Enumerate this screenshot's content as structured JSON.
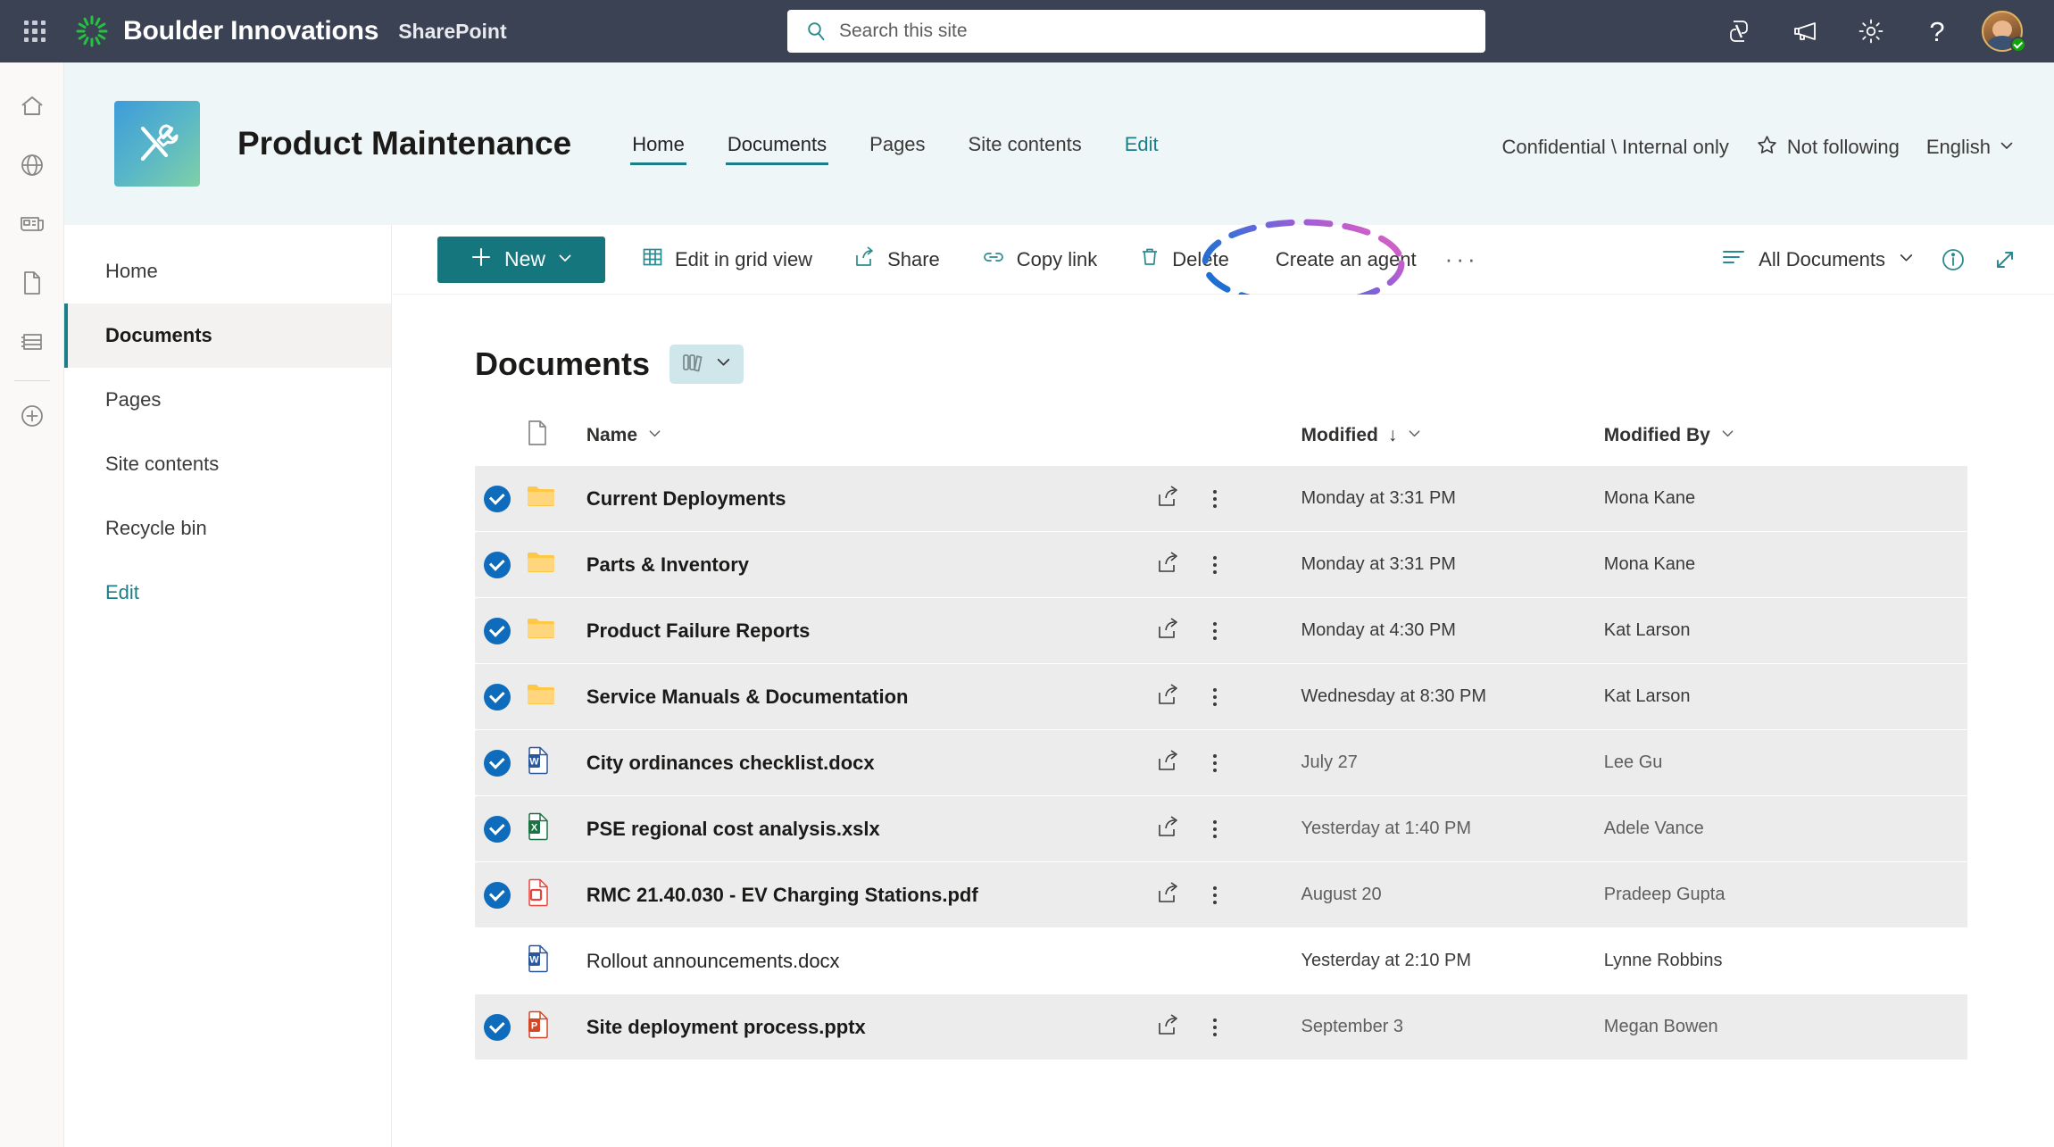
{
  "suite": {
    "waffle_label": "app-launcher",
    "brand": "Boulder Innovations",
    "app": "SharePoint",
    "search_placeholder": "Search this site",
    "icons": [
      "copilot-icon",
      "megaphone-icon",
      "gear-icon",
      "help-icon"
    ],
    "help_glyph": "?",
    "avatar_label": "user-avatar"
  },
  "rail": {
    "items": [
      {
        "name": "home-icon"
      },
      {
        "name": "globe-icon"
      },
      {
        "name": "news-icon"
      },
      {
        "name": "page-icon"
      },
      {
        "name": "lists-icon"
      },
      {
        "name": "create-icon"
      }
    ]
  },
  "site_header": {
    "title": "Product Maintenance",
    "logo_label": "site-logo-tools",
    "nav": [
      {
        "label": "Home",
        "active": false,
        "edit": false
      },
      {
        "label": "Documents",
        "active": true,
        "edit": false
      },
      {
        "label": "Pages",
        "active": false,
        "edit": false
      },
      {
        "label": "Site contents",
        "active": false,
        "edit": false
      },
      {
        "label": "Edit",
        "active": false,
        "edit": true
      }
    ],
    "sensitivity": "Confidential \\ Internal only",
    "follow_label": "Not following",
    "language": "English"
  },
  "side_nav": {
    "items": [
      {
        "label": "Home",
        "active": false,
        "edit": false
      },
      {
        "label": "Documents",
        "active": true,
        "edit": false
      },
      {
        "label": "Pages",
        "active": false,
        "edit": false
      },
      {
        "label": "Site contents",
        "active": false,
        "edit": false
      },
      {
        "label": "Recycle bin",
        "active": false,
        "edit": false
      },
      {
        "label": "Edit",
        "active": false,
        "edit": true
      }
    ]
  },
  "command_bar": {
    "new_label": "New",
    "items": [
      {
        "label": "Edit in grid view",
        "icon": "grid-view-icon"
      },
      {
        "label": "Share",
        "icon": "share-icon"
      },
      {
        "label": "Copy link",
        "icon": "link-icon"
      },
      {
        "label": "Delete",
        "icon": "trash-icon"
      },
      {
        "label": "Create an agent",
        "icon": "none"
      }
    ],
    "overflow": "···",
    "view_label": "All Documents",
    "info_icon": "info-icon",
    "expand_icon": "expand-icon"
  },
  "annotation": {
    "target": "Create an agent",
    "shape": "dashed-oval",
    "gradient_start": "#2b7cd3",
    "gradient_end": "#de6fb8"
  },
  "content": {
    "heading": "Documents",
    "library_pill_icon": "library-icon",
    "columns": [
      {
        "label": "",
        "name": "checkbox-column"
      },
      {
        "label": "",
        "name": "file-type-column"
      },
      {
        "label": "Name",
        "name": "name-column",
        "sort": ""
      },
      {
        "label": "",
        "name": "actions-column"
      },
      {
        "label": "Modified",
        "name": "modified-column",
        "sort": "↓"
      },
      {
        "label": "Modified By",
        "name": "modified-by-column",
        "sort": ""
      }
    ],
    "rows": [
      {
        "name": "Current Deployments",
        "type": "folder",
        "modified": "Monday at 3:31 PM",
        "modified_by": "Mona Kane",
        "selected": true,
        "meta_dark": true
      },
      {
        "name": "Parts & Inventory",
        "type": "folder",
        "modified": "Monday at 3:31 PM",
        "modified_by": "Mona Kane",
        "selected": true,
        "meta_dark": true
      },
      {
        "name": "Product Failure Reports",
        "type": "folder",
        "modified": "Monday at 4:30 PM",
        "modified_by": "Kat Larson",
        "selected": true,
        "meta_dark": true
      },
      {
        "name": "Service Manuals & Documentation",
        "type": "folder",
        "modified": "Wednesday at 8:30 PM",
        "modified_by": "Kat Larson",
        "selected": true,
        "meta_dark": true
      },
      {
        "name": "City ordinances checklist.docx",
        "type": "word",
        "modified": "July 27",
        "modified_by": "Lee Gu",
        "selected": true,
        "meta_dark": false
      },
      {
        "name": "PSE regional cost analysis.xslx",
        "type": "excel",
        "modified": "Yesterday at 1:40 PM",
        "modified_by": "Adele Vance",
        "selected": true,
        "meta_dark": false
      },
      {
        "name": "RMC 21.40.030 - EV Charging Stations.pdf",
        "type": "pdf",
        "modified": "August  20",
        "modified_by": "Pradeep Gupta",
        "selected": true,
        "meta_dark": false
      },
      {
        "name": "Rollout announcements.docx",
        "type": "word",
        "modified": "Yesterday at 2:10 PM",
        "modified_by": "Lynne Robbins",
        "selected": false,
        "meta_dark": true
      },
      {
        "name": "Site deployment process.pptx",
        "type": "ppt",
        "modified": "September 3",
        "modified_by": "Megan Bowen",
        "selected": true,
        "meta_dark": false
      }
    ]
  },
  "colors": {
    "suite_bar": "#3b4253",
    "teal_accent": "#16767d",
    "site_header_bg": "#eff6f8",
    "selected_row": "#ececec",
    "check_blue": "#0f6cbd"
  }
}
